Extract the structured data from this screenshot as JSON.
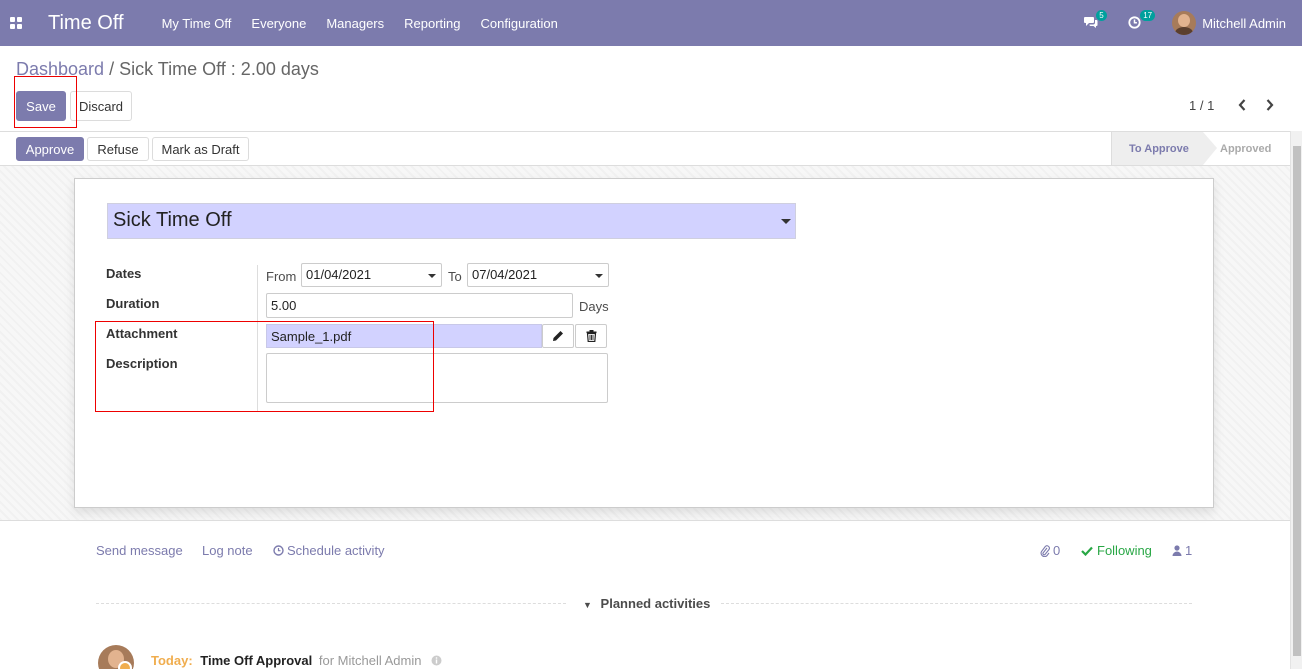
{
  "navbar": {
    "app_title": "Time Off",
    "menu": [
      "My Time Off",
      "Everyone",
      "Managers",
      "Reporting",
      "Configuration"
    ],
    "messages_count": "5",
    "activities_count": "17",
    "user_name": "Mitchell Admin",
    "accent_color": "#7c7bad"
  },
  "breadcrumb": {
    "parent": "Dashboard",
    "separator": "/",
    "current": "Sick Time Off : 2.00 days"
  },
  "control": {
    "save_label": "Save",
    "discard_label": "Discard",
    "pager": "1 / 1"
  },
  "statusbar": {
    "approve_label": "Approve",
    "refuse_label": "Refuse",
    "draft_label": "Mark as Draft",
    "stages": [
      "To Approve",
      "Approved"
    ],
    "current_stage": "To Approve"
  },
  "form": {
    "time_off_type": "Sick Time Off",
    "labels": {
      "dates": "Dates",
      "duration": "Duration",
      "attachment": "Attachment",
      "description": "Description"
    },
    "from_label": "From",
    "from_date": "01/04/2021",
    "to_label": "To",
    "to_date": "07/04/2021",
    "duration_value": "5.00",
    "duration_unit": "Days",
    "attachment_name": "Sample_1.pdf",
    "description": ""
  },
  "chatter": {
    "send_message": "Send message",
    "log_note": "Log note",
    "schedule_activity": "Schedule activity",
    "attachments_count": "0",
    "following": "Following",
    "followers_count": "1",
    "planned_activities": "Planned activities",
    "activity": {
      "when": "Today:",
      "title": "Time Off Approval",
      "for_text": "for Mitchell Admin"
    }
  }
}
